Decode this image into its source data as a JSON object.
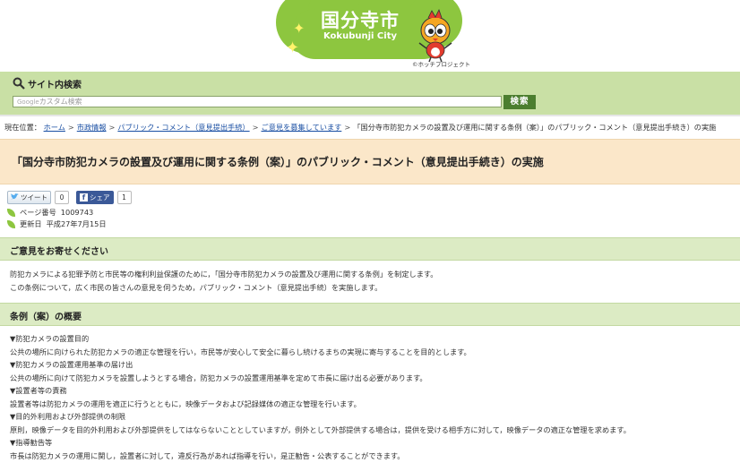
{
  "header": {
    "logo_jp": "国分寺市",
    "logo_en": "Kokubunji City",
    "credit": "©ホッチプロジェクト",
    "brand_green": "#8dc63f"
  },
  "search": {
    "label": "サイト内検索",
    "placeholder": "カスタム検索",
    "google_mark": "Google",
    "button": "検索"
  },
  "breadcrumb": {
    "prefix": "現在位置：",
    "items": [
      "ホーム",
      "市政情報",
      "パブリック・コメント（意見提出手続）",
      "ご意見を募集しています"
    ],
    "current": "「国分寺市防犯カメラの設置及び運用に関する条例（案）」のパブリック・コメント（意見提出手続き）の実施",
    "separator": ">"
  },
  "page": {
    "title": "「国分寺市防犯カメラの設置及び運用に関する条例（案）」のパブリック・コメント（意見提出手続き）の実施",
    "tweet_label": "ツイート",
    "tweet_count": "0",
    "share_label": "シェア",
    "share_count": "1",
    "page_number_label": "ページ番号",
    "page_number": "1009743",
    "updated_label": "更新日",
    "updated": "平成27年7月15日"
  },
  "section1": {
    "heading": "ご意見をお寄せください",
    "lines": [
      "防犯カメラによる犯罪予防と市民等の権利利益保護のために，「国分寺市防犯カメラの設置及び運用に関する条例」を制定します。",
      "この条例について，広く市民の皆さんの意見を伺うため，パブリック・コメント（意見提出手続）を実施します。"
    ]
  },
  "section2": {
    "heading": "条例（案）の概要",
    "lines": [
      "▼防犯カメラの設置目的",
      "公共の場所に向けられた防犯カメラの適正な管理を行い，市民等が安心して安全に暮らし続けるまちの実現に寄与することを目的とします。",
      "▼防犯カメラの設置運用基準の届け出",
      "公共の場所に向けて防犯カメラを設置しようとする場合，防犯カメラの設置運用基準を定めて市長に届け出る必要があります。",
      "▼設置者等の責務",
      "設置者等は防犯カメラの運用を適正に行うとともに，映像データおよび記録媒体の適正な管理を行います。",
      "▼目的外利用および外部提供の制限",
      "原則，映像データを目的外利用および外部提供をしてはならないこととしていますが，例外として外部提供する場合は，提供を受ける相手方に対して，映像データの適正な管理を求めます。",
      "▼指導勧告等",
      "市長は防犯カメラの運用に関し，設置者に対して，違反行為があれば指導を行い，是正勧告・公表することができます。"
    ]
  }
}
